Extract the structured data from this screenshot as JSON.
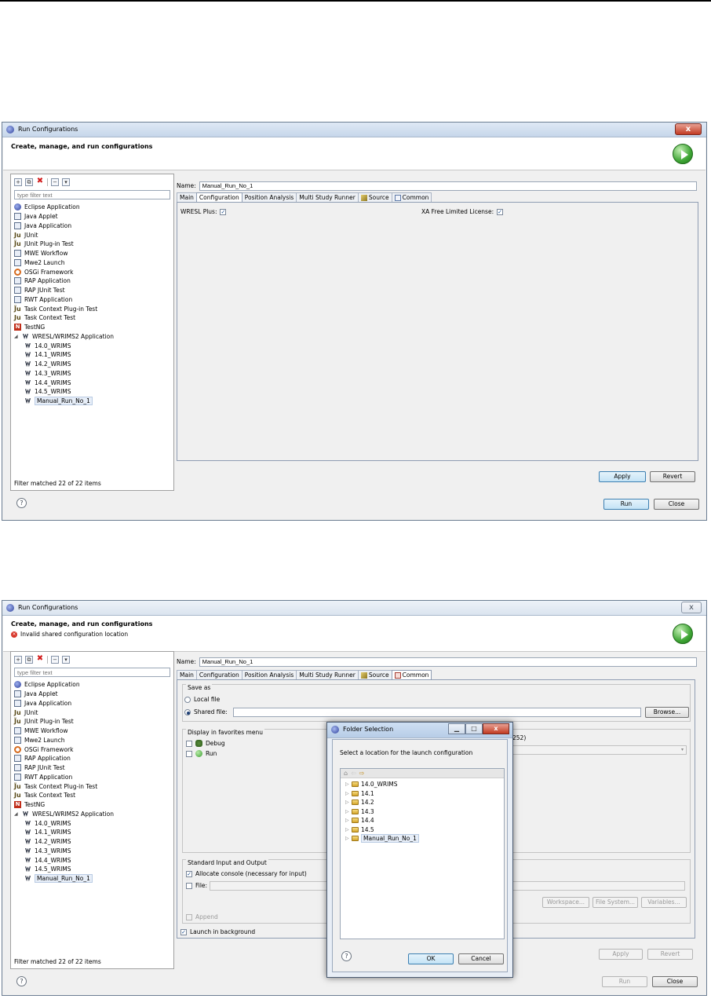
{
  "win1": {
    "title": "Run Configurations",
    "close": "x",
    "header_title": "Create, manage, and run configurations",
    "filter_placeholder": "type filter text",
    "tree": [
      {
        "label": "Eclipse Application",
        "icon": "eclipse-icon"
      },
      {
        "label": "Java Applet",
        "icon": "java-applet-icon"
      },
      {
        "label": "Java Application",
        "icon": "java-app-icon"
      },
      {
        "label": "JUnit",
        "icon": "junit-icon"
      },
      {
        "label": "JUnit Plug-in Test",
        "icon": "junit-plugin-icon"
      },
      {
        "label": "MWE Workflow",
        "icon": "mwe-icon"
      },
      {
        "label": "Mwe2 Launch",
        "icon": "mwe2-icon"
      },
      {
        "label": "OSGi Framework",
        "icon": "osgi-icon"
      },
      {
        "label": "RAP Application",
        "icon": "rap-icon"
      },
      {
        "label": "RAP JUnit Test",
        "icon": "rap-junit-icon"
      },
      {
        "label": "RWT Application",
        "icon": "rwt-icon"
      },
      {
        "label": "Task Context Plug-in Test",
        "icon": "task-plugin-icon"
      },
      {
        "label": "Task Context Test",
        "icon": "task-context-icon"
      },
      {
        "label": "TestNG",
        "icon": "testng-icon"
      },
      {
        "label": "WRESL/WRIMS2 Application",
        "icon": "wrims-icon"
      }
    ],
    "children": [
      "14.0_WRIMS",
      "14.1_WRIMS",
      "14.2_WRIMS",
      "14.3_WRIMS",
      "14.4_WRIMS",
      "14.5_WRIMS",
      "Manual_Run_No_1"
    ],
    "filter_status": "Filter matched 22 of 22 items",
    "name_label": "Name:",
    "name_value": "Manual_Run_No_1",
    "tabs": [
      "Main",
      "Configuration",
      "Position Analysis",
      "Multi Study Runner",
      "Source",
      "Common"
    ],
    "wresl_plus_label": "WRESL Plus:",
    "xa_label": "XA Free Limited License:",
    "apply": "Apply",
    "revert": "Revert",
    "run": "Run",
    "close_btn": "Close",
    "help": "?"
  },
  "win2": {
    "title": "Run Configurations",
    "close": "x",
    "header_title": "Create, manage, and run configurations",
    "error_text": "Invalid shared configuration location",
    "filter_placeholder": "type filter text",
    "filter_status": "Filter matched 22 of 22 items",
    "name_label": "Name:",
    "name_value": "Manual_Run_No_1",
    "tabs": [
      "Main",
      "Configuration",
      "Position Analysis",
      "Multi Study Runner",
      "Source",
      "Common"
    ],
    "save_as": "Save as",
    "local_file": "Local file",
    "shared_file": "Shared file:",
    "browse": "Browse...",
    "favorites": "Display in favorites menu",
    "debug": "Debug",
    "run_fav": "Run",
    "encoding_fragment": "252)",
    "std_io": "Standard Input and Output",
    "allocate_console": "Allocate console (necessary for input)",
    "file_label": "File:",
    "workspace": "Workspace...",
    "file_system": "File System...",
    "variables": "Variables...",
    "append": "Append",
    "launch_bg": "Launch in background",
    "apply": "Apply",
    "revert": "Revert",
    "run": "Run",
    "close_btn": "Close",
    "help": "?"
  },
  "dialog": {
    "title": "Folder Selection",
    "message": "Select a location for the launch configuration",
    "folders": [
      "14.0_WRIMS",
      "14.1",
      "14.2",
      "14.3",
      "14.4",
      "14.5",
      "Manual_Run_No_1"
    ],
    "ok": "OK",
    "cancel": "Cancel",
    "help": "?"
  }
}
